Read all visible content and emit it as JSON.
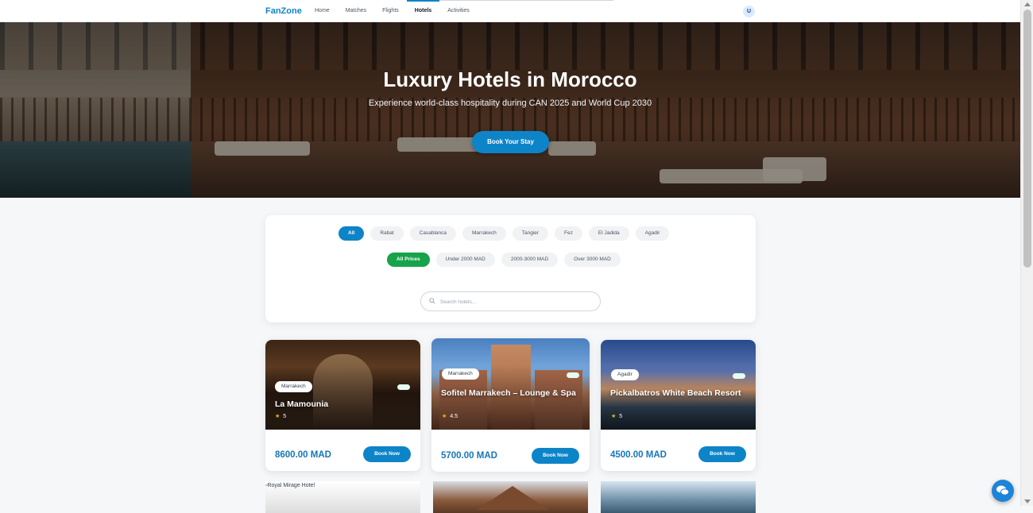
{
  "nav": {
    "brand": "FanZone",
    "links": [
      "Home",
      "Matches",
      "Flights",
      "Hotels",
      "Activities"
    ],
    "active": "Hotels",
    "avatar_letter": "U"
  },
  "hero": {
    "title": "Luxury Hotels in Morocco",
    "subtitle": "Experience world-class hospitality during CAN 2025 and World Cup 2030",
    "cta": "Book Your Stay"
  },
  "filters": {
    "cities": [
      "All",
      "Rabat",
      "Casablanca",
      "Marrakech",
      "Tangier",
      "Fez",
      "El Jadida",
      "Agadir"
    ],
    "active_city": "All",
    "prices": [
      "All Prices",
      "Under 2000 MAD",
      "2000-3000 MAD",
      "Over 3000 MAD"
    ],
    "active_price": "All Prices",
    "search_placeholder": "Search hotels..."
  },
  "hotels": [
    {
      "name": "La Mamounia",
      "city": "Marrakech",
      "rating": "5",
      "price": "8600.00 MAD",
      "book": "Book Now"
    },
    {
      "name": "Sofitel Marrakech – Lounge & Spa",
      "city": "Marrakech",
      "rating": "4.5",
      "price": "5700.00 MAD",
      "book": "Book Now"
    },
    {
      "name": "Pickalbatros White Beach Resort",
      "city": "Agadir",
      "rating": "5",
      "price": "4500.00 MAD",
      "book": "Book Now"
    }
  ],
  "next_row": {
    "broken_image_alt": "Royal Mirage Hotel"
  },
  "colors": {
    "primary": "#0d84c8",
    "price": "#1477b8",
    "active_price_chip": "#16a34a"
  }
}
